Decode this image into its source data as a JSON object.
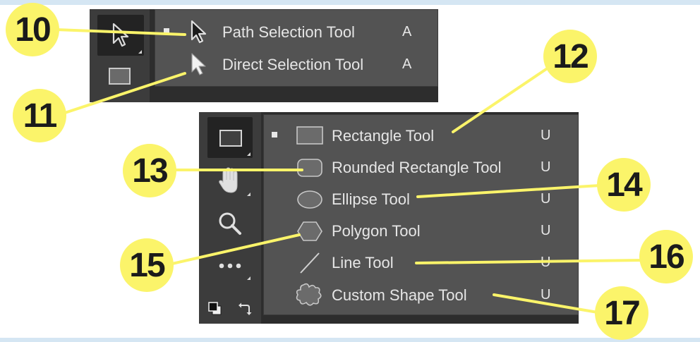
{
  "path_menu": {
    "items": [
      {
        "label": "Path Selection Tool",
        "shortcut": "A",
        "icon": "black-arrow-icon",
        "active": true
      },
      {
        "label": "Direct Selection Tool",
        "shortcut": "A",
        "icon": "white-arrow-icon",
        "active": false
      }
    ]
  },
  "shape_menu": {
    "items": [
      {
        "label": "Rectangle Tool",
        "shortcut": "U",
        "icon": "rectangle-icon",
        "active": true
      },
      {
        "label": "Rounded Rectangle Tool",
        "shortcut": "U",
        "icon": "rounded-rectangle-icon",
        "active": false
      },
      {
        "label": "Ellipse Tool",
        "shortcut": "U",
        "icon": "ellipse-icon",
        "active": false
      },
      {
        "label": "Polygon Tool",
        "shortcut": "U",
        "icon": "polygon-icon",
        "active": false
      },
      {
        "label": "Line Tool",
        "shortcut": "U",
        "icon": "line-icon",
        "active": false
      },
      {
        "label": "Custom Shape Tool",
        "shortcut": "U",
        "icon": "custom-shape-icon",
        "active": false
      }
    ]
  },
  "callouts": {
    "c10": "10",
    "c11": "11",
    "c12": "12",
    "c13": "13",
    "c14": "14",
    "c15": "15",
    "c16": "16",
    "c17": "17"
  },
  "colors": {
    "callout_fill": "#fbf46a",
    "callout_text": "#1b1b1b",
    "menu_bg": "#535353",
    "toolbar_bg": "#3c3c3c"
  }
}
